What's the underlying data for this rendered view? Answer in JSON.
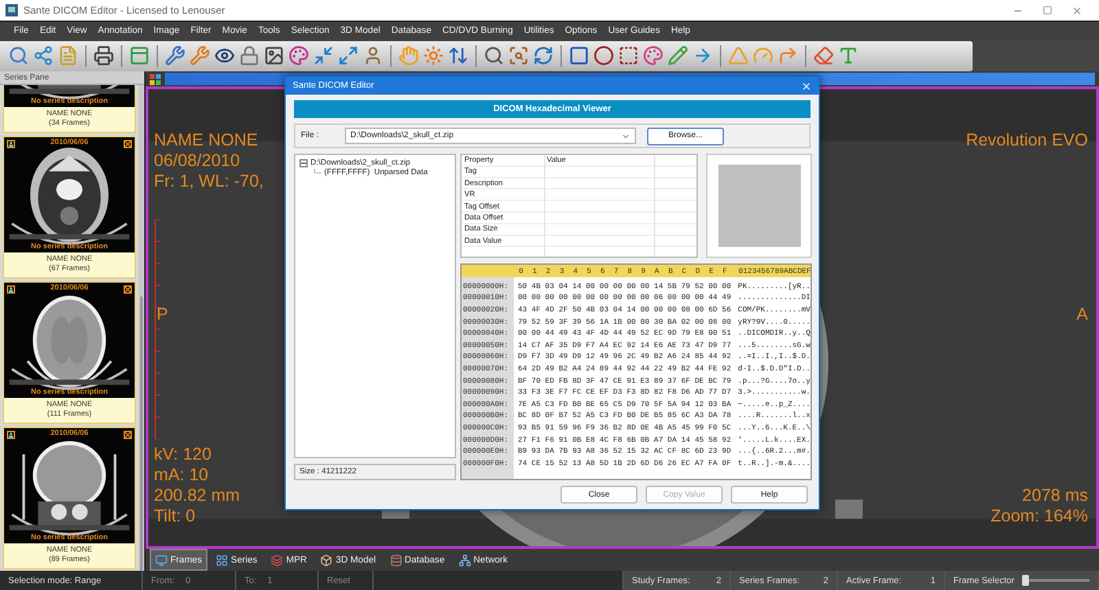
{
  "window": {
    "title": "Sante DICOM Editor - Licensed to Lenouser"
  },
  "menu": [
    "File",
    "Edit",
    "View",
    "Annotation",
    "Image",
    "Filter",
    "Movie",
    "Tools",
    "Selection",
    "3D Model",
    "Database",
    "CD/DVD Burning",
    "Utilities",
    "Options",
    "User Guides",
    "Help"
  ],
  "series_pane": {
    "title": "Series Pane",
    "items": [
      {
        "description": "No series description",
        "name": "NAME NONE",
        "frames": "(34 Frames)"
      },
      {
        "date": "2010/06/06",
        "description": "No series description",
        "name": "NAME NONE",
        "frames": "(67 Frames)"
      },
      {
        "date": "2010/06/06",
        "description": "No series description",
        "name": "NAME NONE",
        "frames": "(111 Frames)"
      },
      {
        "date": "2010/06/06",
        "description": "No series description",
        "name": "NAME NONE",
        "frames": "(89 Frames)"
      }
    ]
  },
  "viewer": {
    "top_left": [
      "NAME NONE",
      "06/08/2010",
      "Fr: 1, WL: -70,"
    ],
    "top_right": [
      "Revolution EVO"
    ],
    "left_orientation": "P",
    "right_orientation": "A",
    "bottom_left": [
      "kV: 120",
      "mA: 10",
      "200.82 mm",
      "Tilt: 0"
    ],
    "bottom_right": [
      "2078 ms",
      "Zoom: 164%"
    ]
  },
  "view_tabs": [
    {
      "label": "Frames",
      "selected": true
    },
    {
      "label": "Series",
      "selected": false
    },
    {
      "label": "MPR",
      "selected": false
    },
    {
      "label": "3D Model",
      "selected": false
    },
    {
      "label": "Database",
      "selected": false
    },
    {
      "label": "Network",
      "selected": false
    }
  ],
  "status_bar": {
    "selection_mode": "Selection mode: Range",
    "from_label": "From:",
    "from_value": "0",
    "to_label": "To:",
    "to_value": "1",
    "reset": "Reset",
    "range_disabled": true,
    "counters": [
      {
        "label": "Study Frames:",
        "value": "2"
      },
      {
        "label": "Series Frames:",
        "value": "2"
      },
      {
        "label": "Active Frame:",
        "value": "1"
      }
    ],
    "frame_selector": {
      "label": "Frame Selector",
      "level": 0
    }
  },
  "dialog": {
    "title": "Sante DICOM Editor",
    "header": "DICOM Hexadecimal Viewer",
    "file_label": "File :",
    "file_value": "D:\\Downloads\\2_skull_ct.zip",
    "browse": "Browse...",
    "tree": [
      {
        "label": "D:\\Downloads\\2_skull_ct.zip",
        "expanded": true,
        "children": [
          {
            "label": "(FFFF,FFFF)  Unparsed Data"
          }
        ]
      }
    ],
    "size": "Size : 41211222",
    "property_columns": [
      "Property",
      "Value"
    ],
    "properties": [
      "Tag",
      "Description",
      "VR",
      "Tag Offset",
      "Data Offset",
      "Data Size",
      "Data Value"
    ],
    "hex_columns": [
      "0",
      "1",
      "2",
      "3",
      "4",
      "5",
      "6",
      "7",
      "8",
      "9",
      "A",
      "B",
      "C",
      "D",
      "E",
      "F"
    ],
    "ascii_header": "0123456789ABCDEF",
    "hex_rows": [
      {
        "offset": "00000000H:",
        "bytes": "50 4B 03 04 14 00 00 00 00 00 14 5B 79 52 00 00",
        "ascii": "PK.........[yR.."
      },
      {
        "offset": "00000010H:",
        "bytes": "00 00 00 00 00 00 00 00 00 00 06 00 00 00 44 49",
        "ascii": "..............DI"
      },
      {
        "offset": "00000020H:",
        "bytes": "43 4F 4D 2F 50 4B 03 04 14 00 00 00 08 00 6D 56",
        "ascii": "COM/PK........mV"
      },
      {
        "offset": "00000030H:",
        "bytes": "79 52 59 3F 39 56 1A 1B 00 00 30 BA 02 00 08 00",
        "ascii": "yRY?9V....0....."
      },
      {
        "offset": "00000040H:",
        "bytes": "00 00 44 49 43 4F 4D 44 49 52 EC 9D 79 E8 00 51",
        "ascii": "..DICOMDIR..y..Q"
      },
      {
        "offset": "00000050H:",
        "bytes": "14 C7 AF 35 D9 F7 A4 EC 92 14 E6 AE 73 47 D9 77",
        "ascii": "...5........sG.w"
      },
      {
        "offset": "00000060H:",
        "bytes": "D9 F7 3D 49 D9 12 49 96 2C 49 B2 A6 24 85 44 92",
        "ascii": "..=I..I.,I..$.D."
      },
      {
        "offset": "00000070H:",
        "bytes": "64 2D 49 B2 A4 24 89 44 92 44 22 49 B2 44 FE 92",
        "ascii": "d-I..$.D.D\"I.D.."
      },
      {
        "offset": "00000080H:",
        "bytes": "BF 70 ED FB 8D 3F 47 CE 91 E3 89 37 6F DE BC 79",
        "ascii": ".p...?G....7o..y"
      },
      {
        "offset": "00000090H:",
        "bytes": "33 F3 3E F7 FC CE EF D3 F3 8D 82 F8 D6 AD 77 D7",
        "ascii": "3.>...........w."
      },
      {
        "offset": "000000A0H:",
        "bytes": "7E A5 C3 FD B0 BE 65 C5 D9 70 5F 5A 94 12 03 BA",
        "ascii": "~.....e..p_Z...."
      },
      {
        "offset": "000000B0H:",
        "bytes": "BC 8D 0F B7 52 A5 C3 FD B0 DE B5 85 6C A3 DA 78",
        "ascii": "....R.......l..x"
      },
      {
        "offset": "000000C0H:",
        "bytes": "93 B5 91 59 96 F9 36 B2 8D 0E 4B A5 45 99 F0 5C",
        "ascii": "...Y..6...K.E..\\"
      },
      {
        "offset": "000000D0H:",
        "bytes": "27 F1 F6 91 0B E8 4C F8 6B 0B A7 DA 14 45 58 92",
        "ascii": "'.....L.k....EX."
      },
      {
        "offset": "000000E0H:",
        "bytes": "B9 93 DA 7B 93 A8 36 52 15 32 AC CF 8C 6D 23 9D",
        "ascii": "...{..6R.2...m#."
      },
      {
        "offset": "000000F0H:",
        "bytes": "74 CE 15 52 13 A8 5D 1B 2D 6D D6 26 EC A7 FA 0F",
        "ascii": "t..R..].-m.&...."
      }
    ],
    "buttons": [
      {
        "label": "Close",
        "disabled": false
      },
      {
        "label": "Copy Value",
        "disabled": true
      },
      {
        "label": "Help",
        "disabled": false
      }
    ]
  }
}
